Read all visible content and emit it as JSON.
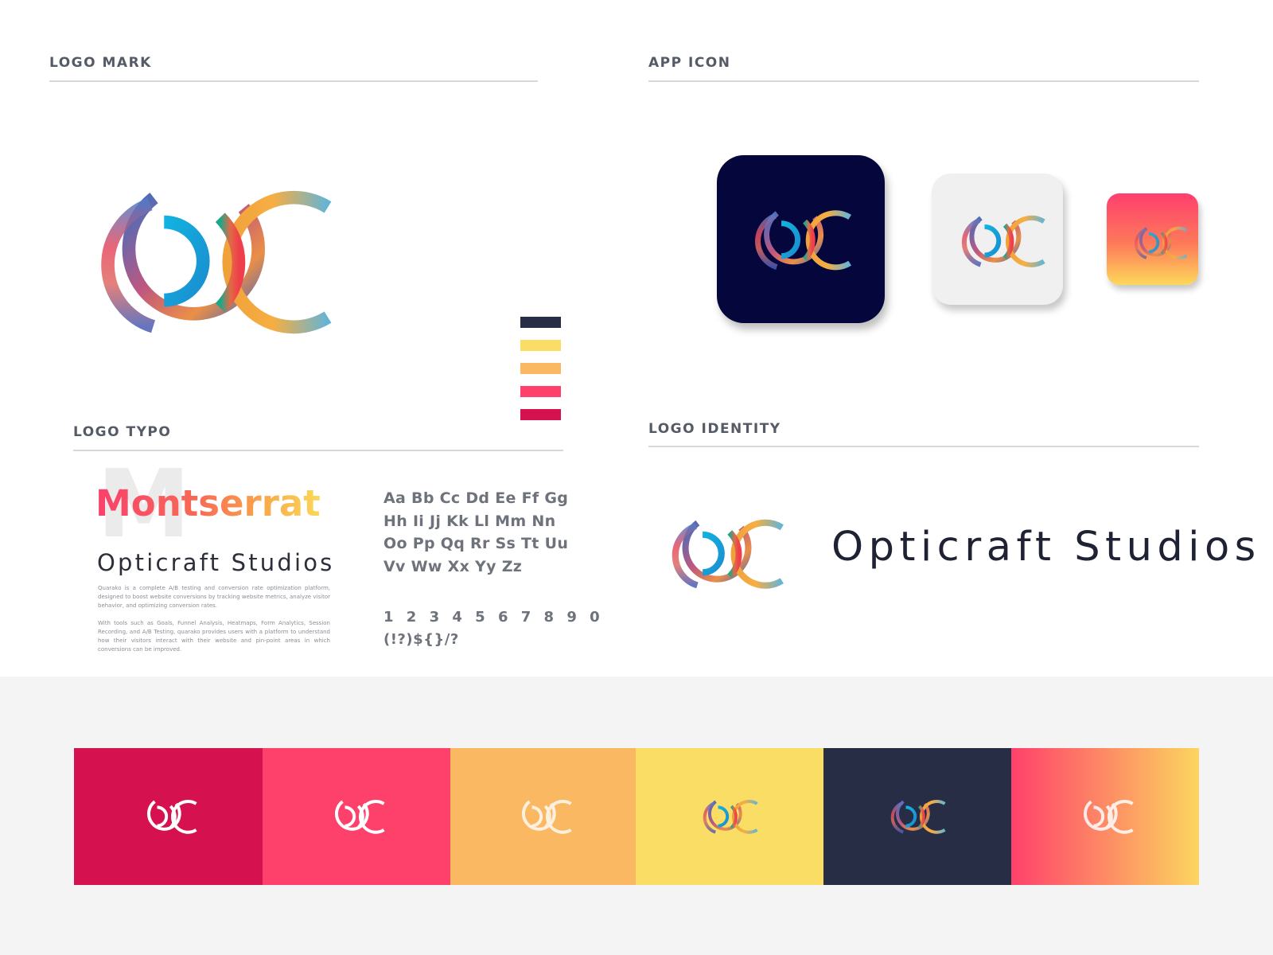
{
  "sections": {
    "logo_mark": {
      "heading": "LOGO MARK"
    },
    "app_icon": {
      "heading": "APP ICON"
    },
    "logo_typo": {
      "heading": "LOGO TYPO"
    },
    "logo_identity": {
      "heading": "LOGO IDENTITY"
    }
  },
  "logo": {
    "icon": "oc-monogram-icon",
    "gradient_colors": [
      "#4f6fb7",
      "#c45a7b",
      "#ef4f4f",
      "#f39a3c",
      "#67b7d1",
      "#1da7d8",
      "#1fa88d"
    ]
  },
  "swatches": [
    {
      "name": "navy",
      "color": "#262d45"
    },
    {
      "name": "yellow",
      "color": "#fadd65"
    },
    {
      "name": "orange",
      "color": "#fbb862"
    },
    {
      "name": "pink",
      "color": "#fe416b"
    },
    {
      "name": "crimson",
      "color": "#d5124f"
    }
  ],
  "typography": {
    "background_letter": "M",
    "font_name": "Montserrat",
    "brand_name": "Opticraft Studios",
    "paragraphs": [
      "Quarako is a complete A/B testing and conversion rate optimization platform, designed to boost website conversions by tracking website metrics, analyze visitor behavior, and optimizing conversion rates.",
      "With tools such as Goals, Funnel Analysis, Heatmaps, Form Analytics, Session Recording, and A/B Testing, quarako provides users with a platform to understand how their visitors interact with their website and pin-point areas in which conversions can be improved."
    ],
    "alphabet_lines": [
      "Aa Bb Cc Dd Ee Ff Gg",
      "Hh Ii Jj Kk Ll Mm Nn",
      "Oo Pp Qq Rr Ss Tt Uu",
      "Vv Ww Xx Yy Zz"
    ],
    "numbers": "1 2 3 4 5 6 7 8 9 0",
    "symbols": "(!?)${}/?"
  },
  "app_icons": [
    {
      "size": "large",
      "background": "#05063c"
    },
    {
      "size": "medium",
      "background": "#f0f0f0"
    },
    {
      "size": "small",
      "background": "gradient pink to yellow"
    }
  ],
  "identity": {
    "brand_name": "Opticraft Studios"
  },
  "palette": [
    {
      "color": "#d5124f",
      "logo_style": "white"
    },
    {
      "color": "#fe416b",
      "logo_style": "white"
    },
    {
      "color": "#fbb862",
      "logo_style": "white"
    },
    {
      "color": "#fadd65",
      "logo_style": "gradient"
    },
    {
      "color": "#262d45",
      "logo_style": "gradient"
    },
    {
      "color": "gradient #fe416b to #fcd55f",
      "logo_style": "white"
    }
  ]
}
